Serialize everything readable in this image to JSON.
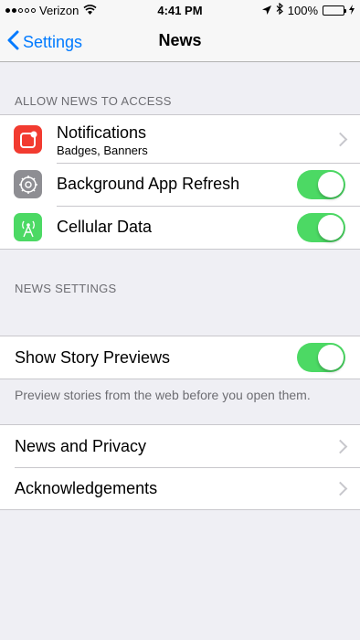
{
  "status_bar": {
    "carrier": "Verizon",
    "time": "4:41 PM",
    "battery": "100%",
    "signal_bars": 2
  },
  "nav": {
    "back_label": "Settings",
    "title": "News"
  },
  "section_access": {
    "header": "ALLOW NEWS TO ACCESS",
    "rows": [
      {
        "label": "Notifications",
        "sublabel": "Badges, Banners",
        "icon": "notifications-icon",
        "icon_color": "#f23b30",
        "accessory": "chevron"
      },
      {
        "label": "Background App Refresh",
        "icon": "gear-icon",
        "icon_color": "#8e8e93",
        "accessory": "toggle",
        "on": true
      },
      {
        "label": "Cellular Data",
        "icon": "antenna-icon",
        "icon_color": "#4cd964",
        "accessory": "toggle",
        "on": true
      }
    ]
  },
  "section_settings": {
    "header": "NEWS SETTINGS",
    "story_previews": {
      "label": "Show Story Previews",
      "on": true
    },
    "footer": "Preview stories from the web before you open them."
  },
  "section_links": {
    "rows": [
      {
        "label": "News and Privacy"
      },
      {
        "label": "Acknowledgements"
      }
    ]
  },
  "colors": {
    "accent": "#007aff",
    "toggle_on": "#4cd964",
    "background": "#efeff4"
  }
}
